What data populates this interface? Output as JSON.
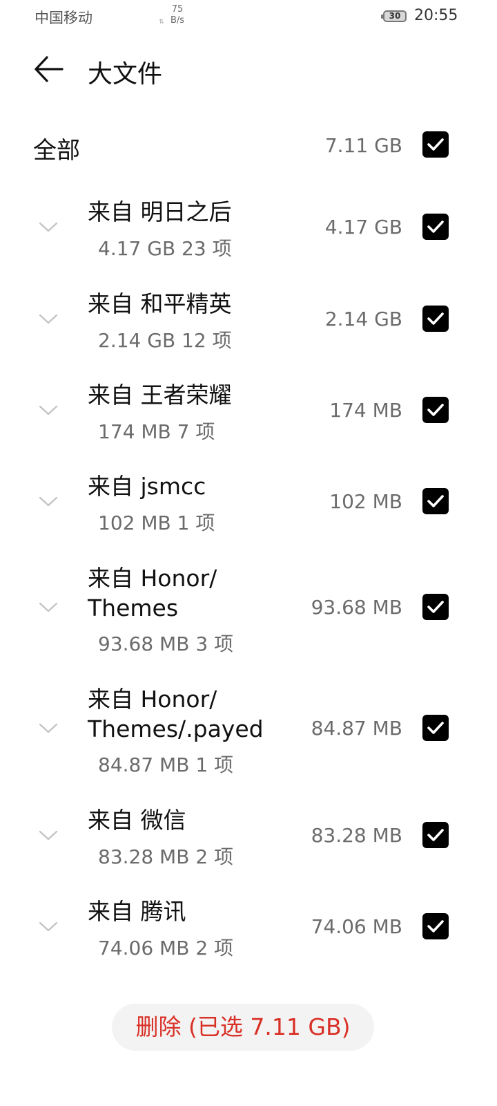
{
  "status": {
    "carrier": "中国移动",
    "net_speed_value": "75",
    "net_speed_unit": "B/s",
    "battery": "30",
    "time": "20:55"
  },
  "header": {
    "title": "大文件"
  },
  "all": {
    "label": "全部",
    "size": "7.11 GB",
    "checked": true
  },
  "items": [
    {
      "title": "来自 明日之后",
      "summary": "4.17 GB 23 项",
      "size": "4.17 GB",
      "checked": true
    },
    {
      "title": "来自 和平精英",
      "summary": "2.14 GB 12 项",
      "size": "2.14 GB",
      "checked": true
    },
    {
      "title": "来自 王者荣耀",
      "summary": "174 MB 7 项",
      "size": "174 MB",
      "checked": true
    },
    {
      "title": "来自 jsmcc",
      "summary": "102 MB 1 项",
      "size": "102 MB",
      "checked": true
    },
    {
      "title_line1": "来自 Honor/",
      "title_line2": "Themes",
      "summary": "93.68 MB 3 项",
      "size": "93.68 MB",
      "checked": true
    },
    {
      "title_line1": "来自 Honor/",
      "title_line2": "Themes/.payed",
      "summary": "84.87 MB 1 项",
      "size": "84.87 MB",
      "checked": true
    },
    {
      "title": "来自 微信",
      "summary": "83.28 MB 2 项",
      "size": "83.28 MB",
      "checked": true
    },
    {
      "title": "来自 腾讯",
      "summary": "74.06 MB 2 项",
      "size": "74.06 MB",
      "checked": true
    }
  ],
  "footer": {
    "delete_label": "删除 (已选 7.11 GB)"
  },
  "icons": {
    "back": "back-arrow-icon",
    "expand": "chevron-down-icon",
    "check": "checkmark-icon"
  },
  "colors": {
    "delete_text": "#d93026",
    "checkbox": "#000000"
  }
}
